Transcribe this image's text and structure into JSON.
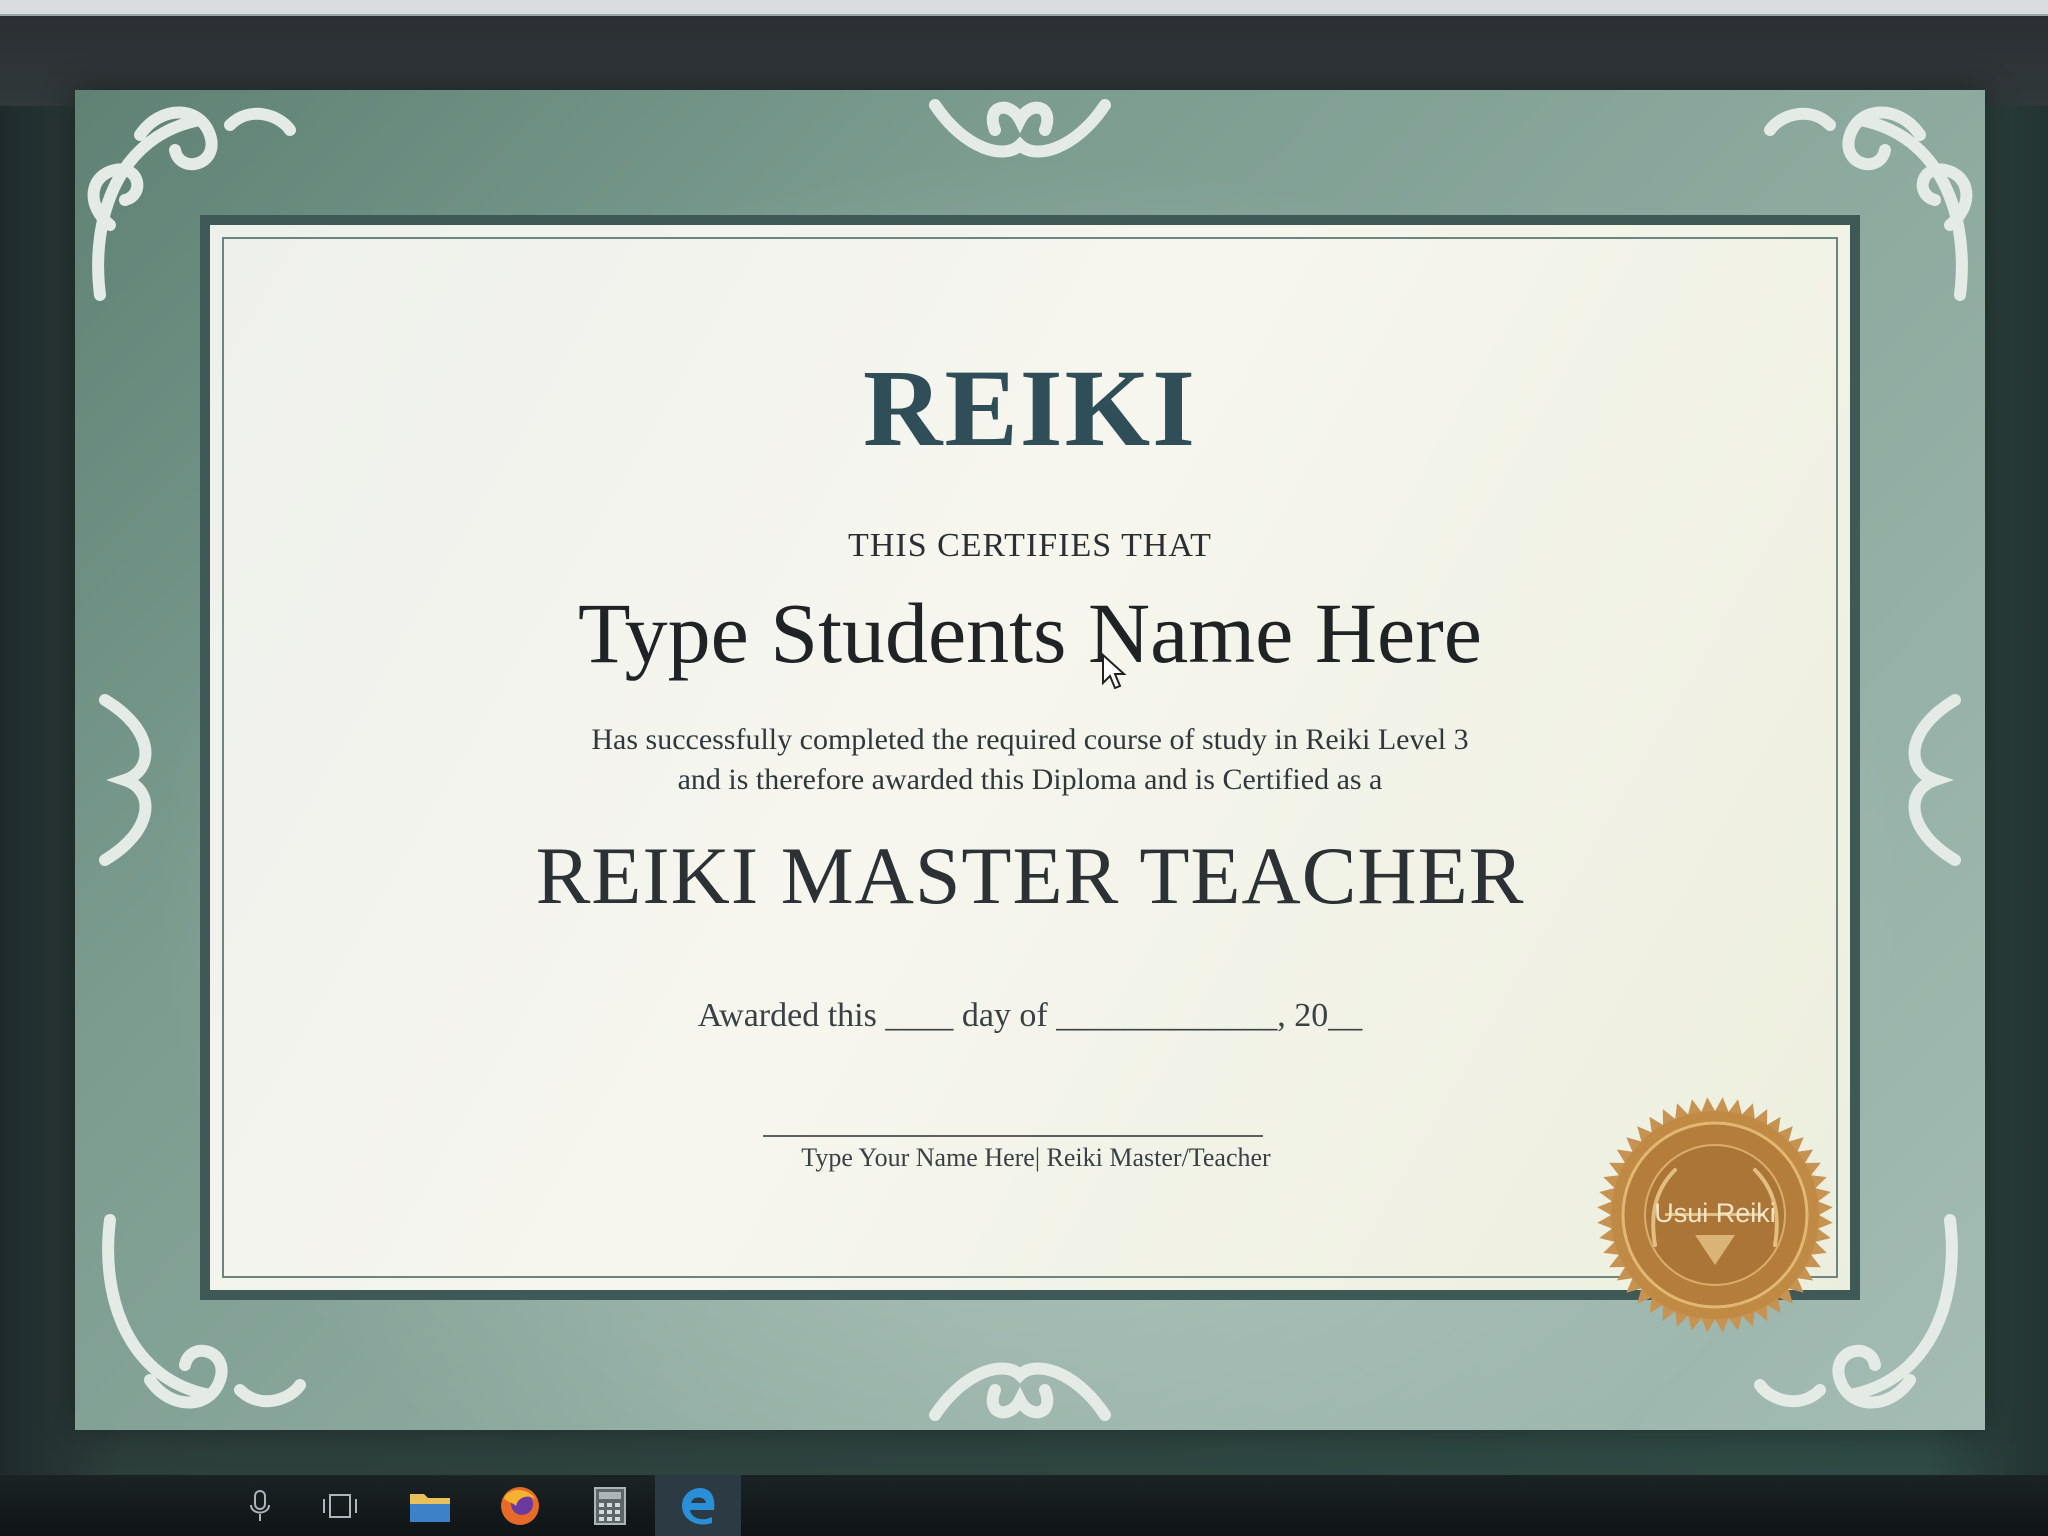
{
  "certificate": {
    "title": "REIKI",
    "certifies": "THIS CERTIFIES THAT",
    "student_name": "Type Students Name Here",
    "description_line1": "Has successfully completed the required course of study in Reiki Level 3",
    "description_line2": "and is therefore awarded this Diploma and is Certified as a",
    "degree": "REIKI MASTER TEACHER",
    "awarded_prefix": "Awarded this",
    "awarded_day_blank": "____",
    "awarded_month_prefix": "day of",
    "awarded_month_blank": "_____________",
    "awarded_year_prefix": ", 20",
    "awarded_year_blank": "__",
    "signature_label": "Type Your Name Here| Reiki Master/Teacher",
    "seal_text": "Usui Reiki"
  },
  "colors": {
    "frame_green": "#7c9c90",
    "title_blue": "#2f4e58",
    "seal_gold": "#c08a45"
  },
  "taskbar": {
    "items": [
      {
        "icon": "microphone-icon"
      },
      {
        "icon": "task-view-icon"
      },
      {
        "icon": "file-explorer-icon"
      },
      {
        "icon": "firefox-icon"
      },
      {
        "icon": "calculator-icon"
      },
      {
        "icon": "edge-icon"
      }
    ]
  }
}
